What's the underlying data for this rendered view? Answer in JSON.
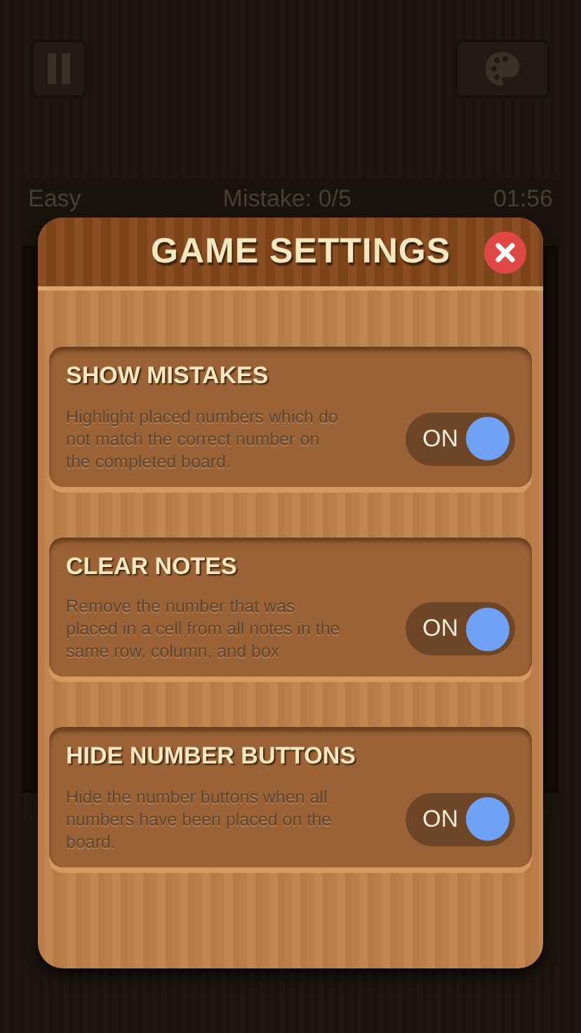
{
  "status_bar": {
    "difficulty": "Easy",
    "mistakes": "Mistake: 0/5",
    "timer": "01:56"
  },
  "dialog": {
    "title": "GAME SETTINGS",
    "settings": [
      {
        "title": "SHOW MISTAKES",
        "description": "Highlight placed numbers which do not match the correct number on the completed board.",
        "on": true,
        "toggle_label": "ON"
      },
      {
        "title": "CLEAR NOTES",
        "description": "Remove the number that was placed in a cell from all notes in the same row, column, and box",
        "on": true,
        "toggle_label": "ON"
      },
      {
        "title": "HIDE NUMBER BUTTONS",
        "description": "Hide the number buttons when all numbers have been placed on the board.",
        "on": true,
        "toggle_label": "ON"
      }
    ]
  }
}
